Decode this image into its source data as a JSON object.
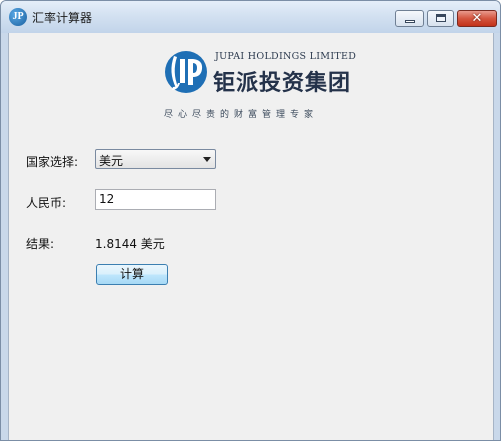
{
  "window": {
    "title": "汇率计算器",
    "app_icon_letter": "JP",
    "close_glyph": "✕"
  },
  "logo": {
    "company_en": "JUPAI HOLDINGS LIMITED",
    "company_cn": "钜派投资集团",
    "slogan": "尽心尽责的财富管理专家",
    "colors": {
      "blue": "#1f6fb5",
      "dark": "#24324a"
    }
  },
  "form": {
    "country_label": "国家选择:",
    "country_selected": "美元",
    "rmb_label": "人民币:",
    "rmb_value": "12",
    "result_label": "结果:",
    "result_value": "1.8144 美元",
    "calc_button": "计算"
  }
}
